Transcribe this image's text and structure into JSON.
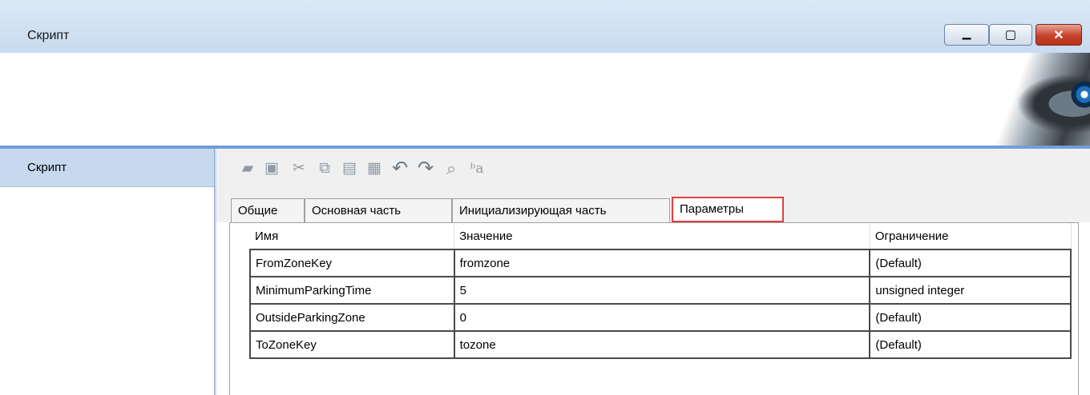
{
  "window": {
    "title": "Скрипт",
    "buttons": {
      "minimize_glyph": "▁",
      "maximize_glyph": "▢",
      "close_glyph": "✕"
    }
  },
  "sidebar": {
    "items": [
      {
        "label": "Скрипт"
      }
    ]
  },
  "toolbar": {
    "icons": [
      {
        "name": "open-folder-icon",
        "glyph": "▰"
      },
      {
        "name": "save-icon",
        "glyph": "▣"
      },
      {
        "name": "cut-icon",
        "glyph": "✂"
      },
      {
        "name": "copy-icon",
        "glyph": "⧉"
      },
      {
        "name": "paste-icon",
        "glyph": "▤"
      },
      {
        "name": "delete-doc-icon",
        "glyph": "▦"
      },
      {
        "name": "undo-icon",
        "glyph": "↶"
      },
      {
        "name": "redo-icon",
        "glyph": "↷"
      },
      {
        "name": "find-icon",
        "glyph": "⌕"
      },
      {
        "name": "replace-icon",
        "glyph": "ᵇa"
      }
    ]
  },
  "tabs": [
    {
      "label": "Общие"
    },
    {
      "label": "Основная часть"
    },
    {
      "label": "Инициализирующая часть"
    },
    {
      "label": "Параметры",
      "active": true
    }
  ],
  "grid": {
    "columns": [
      "Имя",
      "Значение",
      "Ограничение"
    ],
    "rows": [
      [
        "FromZoneKey",
        "fromzone",
        "(Default)"
      ],
      [
        "MinimumParkingTime",
        "5",
        "unsigned integer"
      ],
      [
        "OutsideParkingZone",
        "0",
        "(Default)"
      ],
      [
        "ToZoneKey",
        "tozone",
        "(Default)"
      ]
    ]
  },
  "colors": {
    "accent_header_border": "#6f9fd8",
    "active_tab_highlight": "#e04040",
    "sidebar_selected": "#c6d9ee"
  }
}
